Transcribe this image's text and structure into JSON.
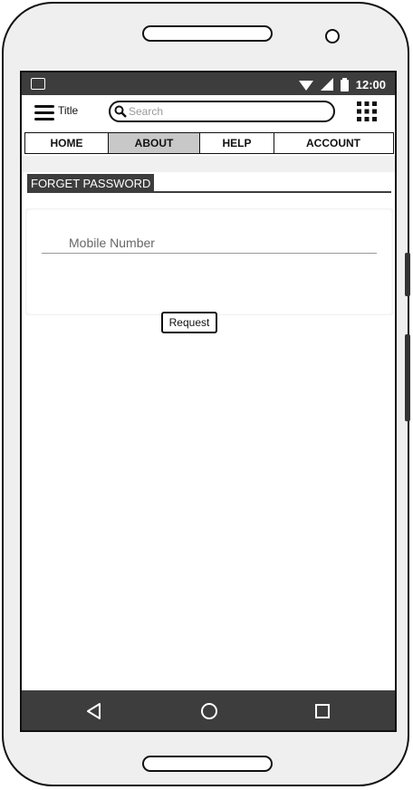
{
  "statusbar": {
    "time": "12:00"
  },
  "appbar": {
    "title": "Title",
    "search_placeholder": "Search"
  },
  "tabs": [
    {
      "label": "HOME",
      "active": false
    },
    {
      "label": "ABOUT",
      "active": true
    },
    {
      "label": "HELP",
      "active": false
    },
    {
      "label": "ACCOUNT",
      "active": false
    }
  ],
  "form": {
    "section_title": "FORGET PASSWORD",
    "mobile_placeholder": "Mobile Number",
    "request_label": "Request"
  },
  "icons": {
    "menu": "hamburger-menu-icon",
    "search": "search-icon",
    "apps": "grid-apps-icon",
    "back": "back-triangle-icon",
    "home": "home-circle-icon",
    "recents": "recents-square-icon"
  },
  "colors": {
    "bars": "#3d3d3d",
    "active_tab": "#c8c8c8",
    "phone_body": "#efefef"
  }
}
